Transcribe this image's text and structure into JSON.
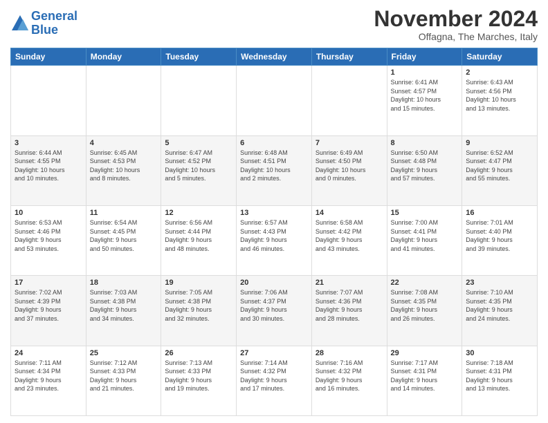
{
  "header": {
    "logo_line1": "General",
    "logo_line2": "Blue",
    "month_title": "November 2024",
    "location": "Offagna, The Marches, Italy"
  },
  "days_of_week": [
    "Sunday",
    "Monday",
    "Tuesday",
    "Wednesday",
    "Thursday",
    "Friday",
    "Saturday"
  ],
  "weeks": [
    [
      {
        "day": "",
        "info": ""
      },
      {
        "day": "",
        "info": ""
      },
      {
        "day": "",
        "info": ""
      },
      {
        "day": "",
        "info": ""
      },
      {
        "day": "",
        "info": ""
      },
      {
        "day": "1",
        "info": "Sunrise: 6:41 AM\nSunset: 4:57 PM\nDaylight: 10 hours\nand 15 minutes."
      },
      {
        "day": "2",
        "info": "Sunrise: 6:43 AM\nSunset: 4:56 PM\nDaylight: 10 hours\nand 13 minutes."
      }
    ],
    [
      {
        "day": "3",
        "info": "Sunrise: 6:44 AM\nSunset: 4:55 PM\nDaylight: 10 hours\nand 10 minutes."
      },
      {
        "day": "4",
        "info": "Sunrise: 6:45 AM\nSunset: 4:53 PM\nDaylight: 10 hours\nand 8 minutes."
      },
      {
        "day": "5",
        "info": "Sunrise: 6:47 AM\nSunset: 4:52 PM\nDaylight: 10 hours\nand 5 minutes."
      },
      {
        "day": "6",
        "info": "Sunrise: 6:48 AM\nSunset: 4:51 PM\nDaylight: 10 hours\nand 2 minutes."
      },
      {
        "day": "7",
        "info": "Sunrise: 6:49 AM\nSunset: 4:50 PM\nDaylight: 10 hours\nand 0 minutes."
      },
      {
        "day": "8",
        "info": "Sunrise: 6:50 AM\nSunset: 4:48 PM\nDaylight: 9 hours\nand 57 minutes."
      },
      {
        "day": "9",
        "info": "Sunrise: 6:52 AM\nSunset: 4:47 PM\nDaylight: 9 hours\nand 55 minutes."
      }
    ],
    [
      {
        "day": "10",
        "info": "Sunrise: 6:53 AM\nSunset: 4:46 PM\nDaylight: 9 hours\nand 53 minutes."
      },
      {
        "day": "11",
        "info": "Sunrise: 6:54 AM\nSunset: 4:45 PM\nDaylight: 9 hours\nand 50 minutes."
      },
      {
        "day": "12",
        "info": "Sunrise: 6:56 AM\nSunset: 4:44 PM\nDaylight: 9 hours\nand 48 minutes."
      },
      {
        "day": "13",
        "info": "Sunrise: 6:57 AM\nSunset: 4:43 PM\nDaylight: 9 hours\nand 46 minutes."
      },
      {
        "day": "14",
        "info": "Sunrise: 6:58 AM\nSunset: 4:42 PM\nDaylight: 9 hours\nand 43 minutes."
      },
      {
        "day": "15",
        "info": "Sunrise: 7:00 AM\nSunset: 4:41 PM\nDaylight: 9 hours\nand 41 minutes."
      },
      {
        "day": "16",
        "info": "Sunrise: 7:01 AM\nSunset: 4:40 PM\nDaylight: 9 hours\nand 39 minutes."
      }
    ],
    [
      {
        "day": "17",
        "info": "Sunrise: 7:02 AM\nSunset: 4:39 PM\nDaylight: 9 hours\nand 37 minutes."
      },
      {
        "day": "18",
        "info": "Sunrise: 7:03 AM\nSunset: 4:38 PM\nDaylight: 9 hours\nand 34 minutes."
      },
      {
        "day": "19",
        "info": "Sunrise: 7:05 AM\nSunset: 4:38 PM\nDaylight: 9 hours\nand 32 minutes."
      },
      {
        "day": "20",
        "info": "Sunrise: 7:06 AM\nSunset: 4:37 PM\nDaylight: 9 hours\nand 30 minutes."
      },
      {
        "day": "21",
        "info": "Sunrise: 7:07 AM\nSunset: 4:36 PM\nDaylight: 9 hours\nand 28 minutes."
      },
      {
        "day": "22",
        "info": "Sunrise: 7:08 AM\nSunset: 4:35 PM\nDaylight: 9 hours\nand 26 minutes."
      },
      {
        "day": "23",
        "info": "Sunrise: 7:10 AM\nSunset: 4:35 PM\nDaylight: 9 hours\nand 24 minutes."
      }
    ],
    [
      {
        "day": "24",
        "info": "Sunrise: 7:11 AM\nSunset: 4:34 PM\nDaylight: 9 hours\nand 23 minutes."
      },
      {
        "day": "25",
        "info": "Sunrise: 7:12 AM\nSunset: 4:33 PM\nDaylight: 9 hours\nand 21 minutes."
      },
      {
        "day": "26",
        "info": "Sunrise: 7:13 AM\nSunset: 4:33 PM\nDaylight: 9 hours\nand 19 minutes."
      },
      {
        "day": "27",
        "info": "Sunrise: 7:14 AM\nSunset: 4:32 PM\nDaylight: 9 hours\nand 17 minutes."
      },
      {
        "day": "28",
        "info": "Sunrise: 7:16 AM\nSunset: 4:32 PM\nDaylight: 9 hours\nand 16 minutes."
      },
      {
        "day": "29",
        "info": "Sunrise: 7:17 AM\nSunset: 4:31 PM\nDaylight: 9 hours\nand 14 minutes."
      },
      {
        "day": "30",
        "info": "Sunrise: 7:18 AM\nSunset: 4:31 PM\nDaylight: 9 hours\nand 13 minutes."
      }
    ]
  ]
}
